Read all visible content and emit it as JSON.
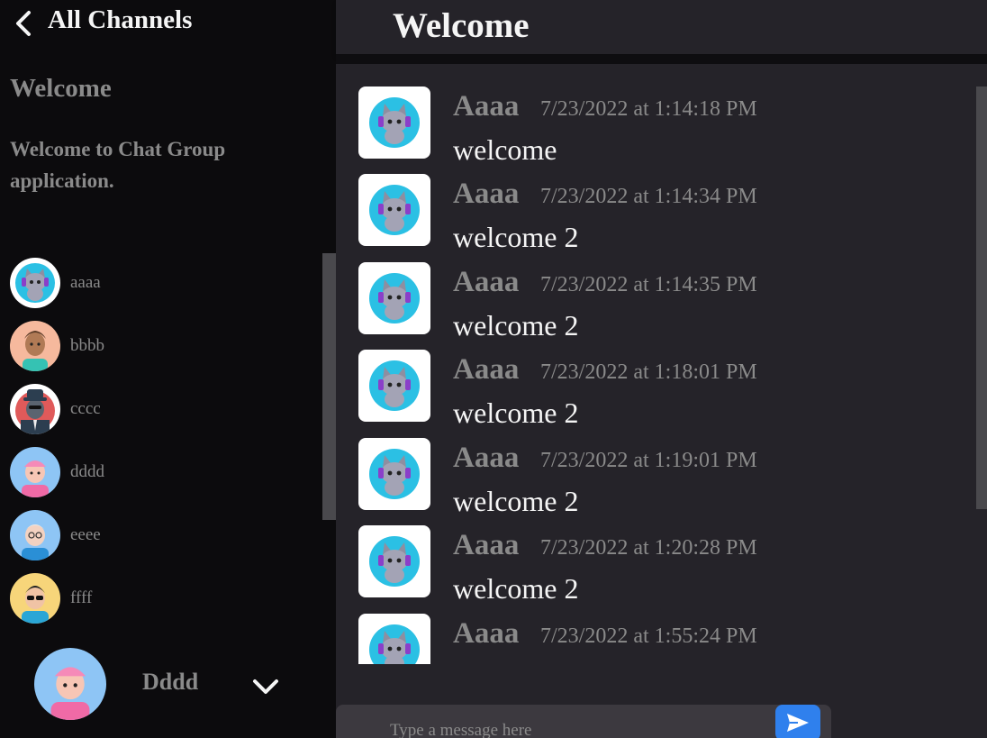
{
  "sidebar": {
    "header_title": "All Channels",
    "channel": {
      "name": "Welcome",
      "description": "Welcome to Chat Group application."
    },
    "members": [
      {
        "name": "aaaa",
        "avatar": "cat-headphones-avatar"
      },
      {
        "name": "bbbb",
        "avatar": "man-curly-avatar"
      },
      {
        "name": "cccc",
        "avatar": "spy-hat-avatar"
      },
      {
        "name": "dddd",
        "avatar": "pink-cap-avatar"
      },
      {
        "name": "eeee",
        "avatar": "old-man-glasses-avatar"
      },
      {
        "name": "ffff",
        "avatar": "sunglasses-avatar"
      }
    ],
    "current_user": {
      "name": "Dddd",
      "avatar": "pink-cap-avatar"
    }
  },
  "main": {
    "title": "Welcome",
    "messages": [
      {
        "author": "Aaaa",
        "time": "7/23/2022 at 1:14:18 PM",
        "text": "welcome"
      },
      {
        "author": "Aaaa",
        "time": "7/23/2022 at 1:14:34 PM",
        "text": "welcome 2"
      },
      {
        "author": "Aaaa",
        "time": "7/23/2022 at 1:14:35 PM",
        "text": "welcome 2"
      },
      {
        "author": "Aaaa",
        "time": "7/23/2022 at 1:18:01 PM",
        "text": "welcome 2"
      },
      {
        "author": "Aaaa",
        "time": "7/23/2022 at 1:19:01 PM",
        "text": "welcome 2"
      },
      {
        "author": "Aaaa",
        "time": "7/23/2022 at 1:20:28 PM",
        "text": "welcome 2"
      },
      {
        "author": "Aaaa",
        "time": "7/23/2022 at 1:55:24 PM",
        "text": ""
      }
    ],
    "composer": {
      "placeholder": "Type a message here"
    }
  },
  "colors": {
    "sidebar_bg": "#0c0b0d",
    "main_bg": "#252329",
    "accent": "#2f80ed",
    "muted_text": "#8a8a8a",
    "primary_text": "#f5f5f5"
  }
}
